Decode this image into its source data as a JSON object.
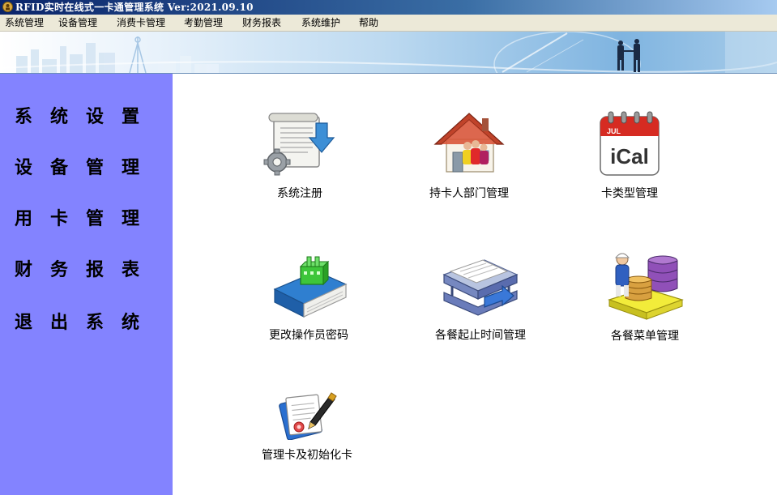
{
  "window": {
    "title": "RFID实时在线式一卡通管理系统 Ver:2021.09.10",
    "icon": "app-icon"
  },
  "menubar": {
    "items": [
      {
        "label": "系统管理"
      },
      {
        "label": "设备管理"
      },
      {
        "label": "消费卡管理"
      },
      {
        "label": "考勤管理"
      },
      {
        "label": "财务报表"
      },
      {
        "label": "系统维护"
      },
      {
        "label": "帮助"
      }
    ]
  },
  "sidebar": {
    "background": "#8383ff",
    "items": [
      {
        "label": "系统设置"
      },
      {
        "label": "设备管理"
      },
      {
        "label": "用卡管理"
      },
      {
        "label": "财务报表"
      },
      {
        "label": "退出系统"
      }
    ]
  },
  "main": {
    "items": [
      {
        "label": "系统注册",
        "icon": "system-register-icon"
      },
      {
        "label": "持卡人部门管理",
        "icon": "cardholder-house-icon"
      },
      {
        "label": "卡类型管理",
        "icon": "ical-calendar-icon",
        "icon_text": "iCal",
        "icon_month": "JUL"
      },
      {
        "label": "更改操作员密码",
        "icon": "operator-password-book-icon"
      },
      {
        "label": "各餐起止时间管理",
        "icon": "meal-time-tray-icon"
      },
      {
        "label": "各餐菜单管理",
        "icon": "meal-menu-database-icon"
      },
      {
        "label": "管理卡及初始化卡",
        "icon": "init-card-document-icon"
      }
    ]
  }
}
